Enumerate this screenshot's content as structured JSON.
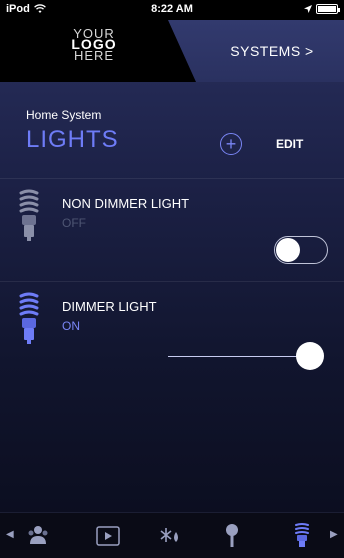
{
  "status_bar": {
    "carrier": "iPod",
    "time": "8:22 AM"
  },
  "header": {
    "logo_lines": [
      "YOUR",
      "LOGO",
      "HERE"
    ],
    "systems_label": "SYSTEMS >"
  },
  "section": {
    "subtitle": "Home System",
    "title": "LIGHTS",
    "add_label": "+",
    "edit_label": "EDIT"
  },
  "lights": [
    {
      "name": "NON DIMMER LIGHT",
      "status": "OFF",
      "on": false,
      "control": "toggle"
    },
    {
      "name": "DIMMER LIGHT",
      "status": "ON",
      "on": true,
      "control": "slider",
      "level": 1.0
    }
  ],
  "bottom_nav": {
    "items": [
      "people-icon",
      "play-icon",
      "climate-icon",
      "irrigation-icon",
      "bulb-icon"
    ],
    "active": "bulb-icon"
  },
  "colors": {
    "accent": "#6e7cf7",
    "active_icon": "#6e7cf7",
    "inactive_icon": "#9aa0c0",
    "status_off": "#4e5573",
    "status_on": "#7a86f5"
  }
}
